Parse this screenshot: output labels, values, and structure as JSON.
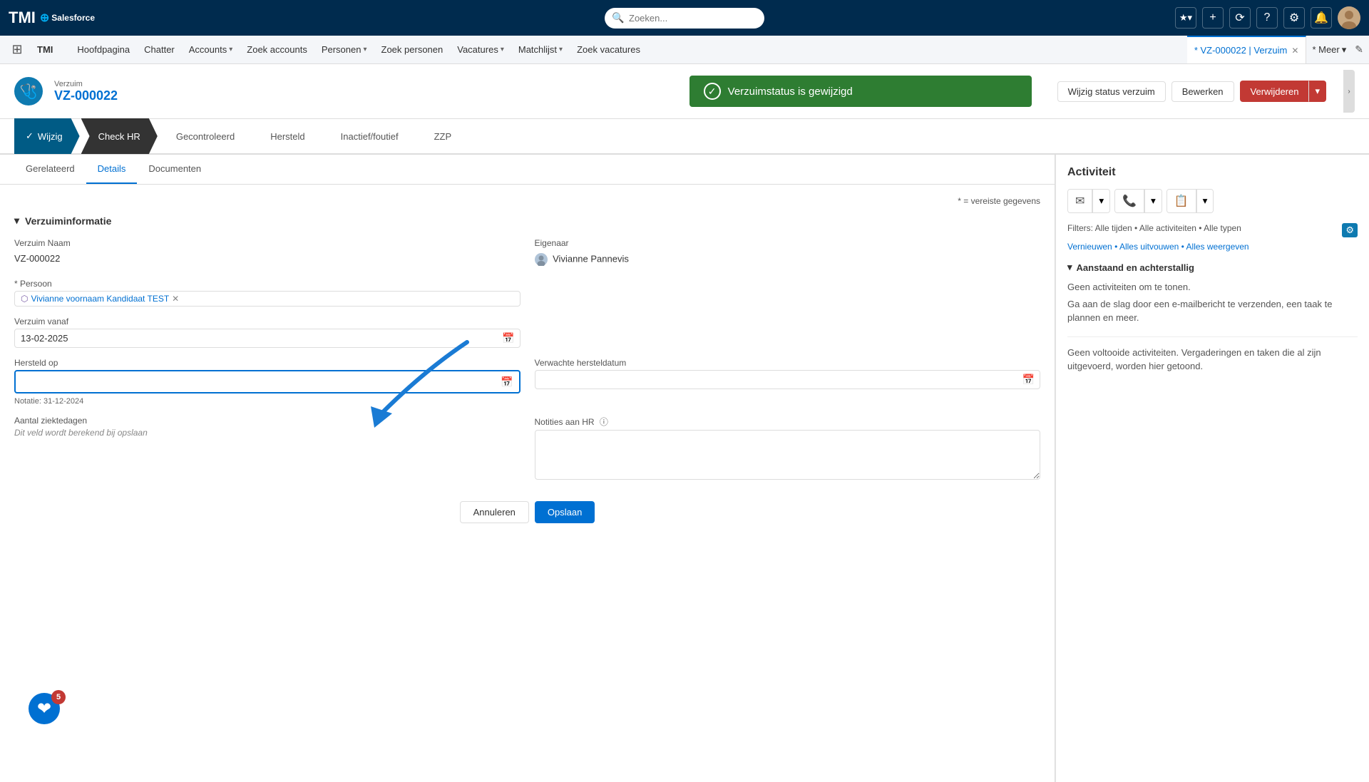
{
  "topnav": {
    "logo_tmi": "TMI",
    "logo_sf": "⊕ Salesforce",
    "search_placeholder": "Zoeken...",
    "icons": [
      "★▾",
      "+",
      "⟳",
      "?",
      "⚙",
      "🔔"
    ],
    "avatar": "👤"
  },
  "appnav": {
    "grid_icon": "⊞",
    "app_name": "TMI",
    "nav_items": [
      {
        "label": "Hoofdpagina",
        "has_chevron": false
      },
      {
        "label": "Chatter",
        "has_chevron": false
      },
      {
        "label": "Accounts",
        "has_chevron": true
      },
      {
        "label": "Zoek accounts",
        "has_chevron": false
      },
      {
        "label": "Personen",
        "has_chevron": true
      },
      {
        "label": "Zoek personen",
        "has_chevron": false
      },
      {
        "label": "Vacatures",
        "has_chevron": true
      },
      {
        "label": "Matchlijst",
        "has_chevron": true
      },
      {
        "label": "Zoek vacatures",
        "has_chevron": false
      }
    ],
    "tabs": [
      {
        "label": "* VZ-000022 | Verzuim",
        "active": true,
        "closeable": true
      },
      {
        "label": "* Meer",
        "has_chevron": true,
        "closeable": false
      }
    ],
    "edit_icon": "✎"
  },
  "record_header": {
    "icon": "🩺",
    "record_type": "Verzuim",
    "record_name": "VZ-000022",
    "success_message": "Verzuimstatus is gewijzigd",
    "actions": {
      "status_btn": "Wijzig status verzuim",
      "edit_btn": "Bewerken",
      "delete_btn": "Verwijderen",
      "dropdown_icon": "▾"
    }
  },
  "stage_bar": {
    "stages": [
      {
        "label": "Wijzig",
        "completed": true
      },
      {
        "label": "Check HR",
        "active": false
      },
      {
        "label": "Gecontroleerd",
        "active": false
      },
      {
        "label": "Hersteld",
        "active": false
      },
      {
        "label": "Inactief/foutief",
        "active": false
      },
      {
        "label": "ZZP",
        "active": false
      }
    ]
  },
  "tabs": {
    "items": [
      "Gerelateerd",
      "Details",
      "Documenten"
    ],
    "active": "Details"
  },
  "form": {
    "required_note": "* = vereiste gegevens",
    "section_title": "Verzuiminformatie",
    "fields": {
      "verzuim_naam_label": "Verzuim Naam",
      "verzuim_naam_value": "VZ-000022",
      "eigenaar_label": "Eigenaar",
      "eigenaar_value": "Vivianne Pannevis",
      "persoon_label": "* Persoon",
      "persoon_value": "Vivianne voornaam Kandidaat TEST",
      "verzuim_vanaf_label": "Verzuim vanaf",
      "verzuim_vanaf_value": "13-02-2025",
      "verzuim_vanaf_placeholder": "",
      "hersteld_op_label": "Hersteld op",
      "hersteld_op_value": "",
      "hersteld_op_notation": "Notatie: 31-12-2024",
      "verwachte_hersteldatum_label": "Verwachte hersteldatum",
      "verwachte_hersteldatum_value": "",
      "aantal_ziektedagen_label": "Aantal ziektedagen",
      "aantal_ziektedagen_value": "Dit veld wordt berekend bij opslaan",
      "notities_aan_hr_label": "Notities aan HR",
      "notities_aan_hr_value": "",
      "notities_info_icon": "ⓘ"
    },
    "buttons": {
      "cancel": "Annuleren",
      "save": "Opslaan"
    }
  },
  "activity": {
    "title": "Activiteit",
    "buttons": [
      {
        "icon": "✉",
        "label": "",
        "type": "email"
      },
      {
        "icon": "📞",
        "label": "",
        "type": "call"
      },
      {
        "icon": "📋",
        "label": "",
        "type": "task"
      }
    ],
    "filters_label": "Filters: Alle tijden • Alle activiteiten • Alle typen",
    "links": {
      "vernieuwen": "Vernieuwen",
      "alles_uitvouwen": "Alles uitvouwen",
      "alles_weergeven": "Alles weergeven"
    },
    "section": {
      "title": "Aanstaand en achterstallig",
      "empty_message": "Geen activiteiten om te tonen.",
      "cta": "Ga aan de slag door een e-mailbericht te verzenden, een taak te plannen en meer.",
      "no_completed": "Geen voltooide activiteiten. Vergaderingen en taken die al zijn uitgevoerd, worden hier getoond."
    }
  },
  "floating_badge": {
    "count": "5",
    "icon": "❤"
  }
}
